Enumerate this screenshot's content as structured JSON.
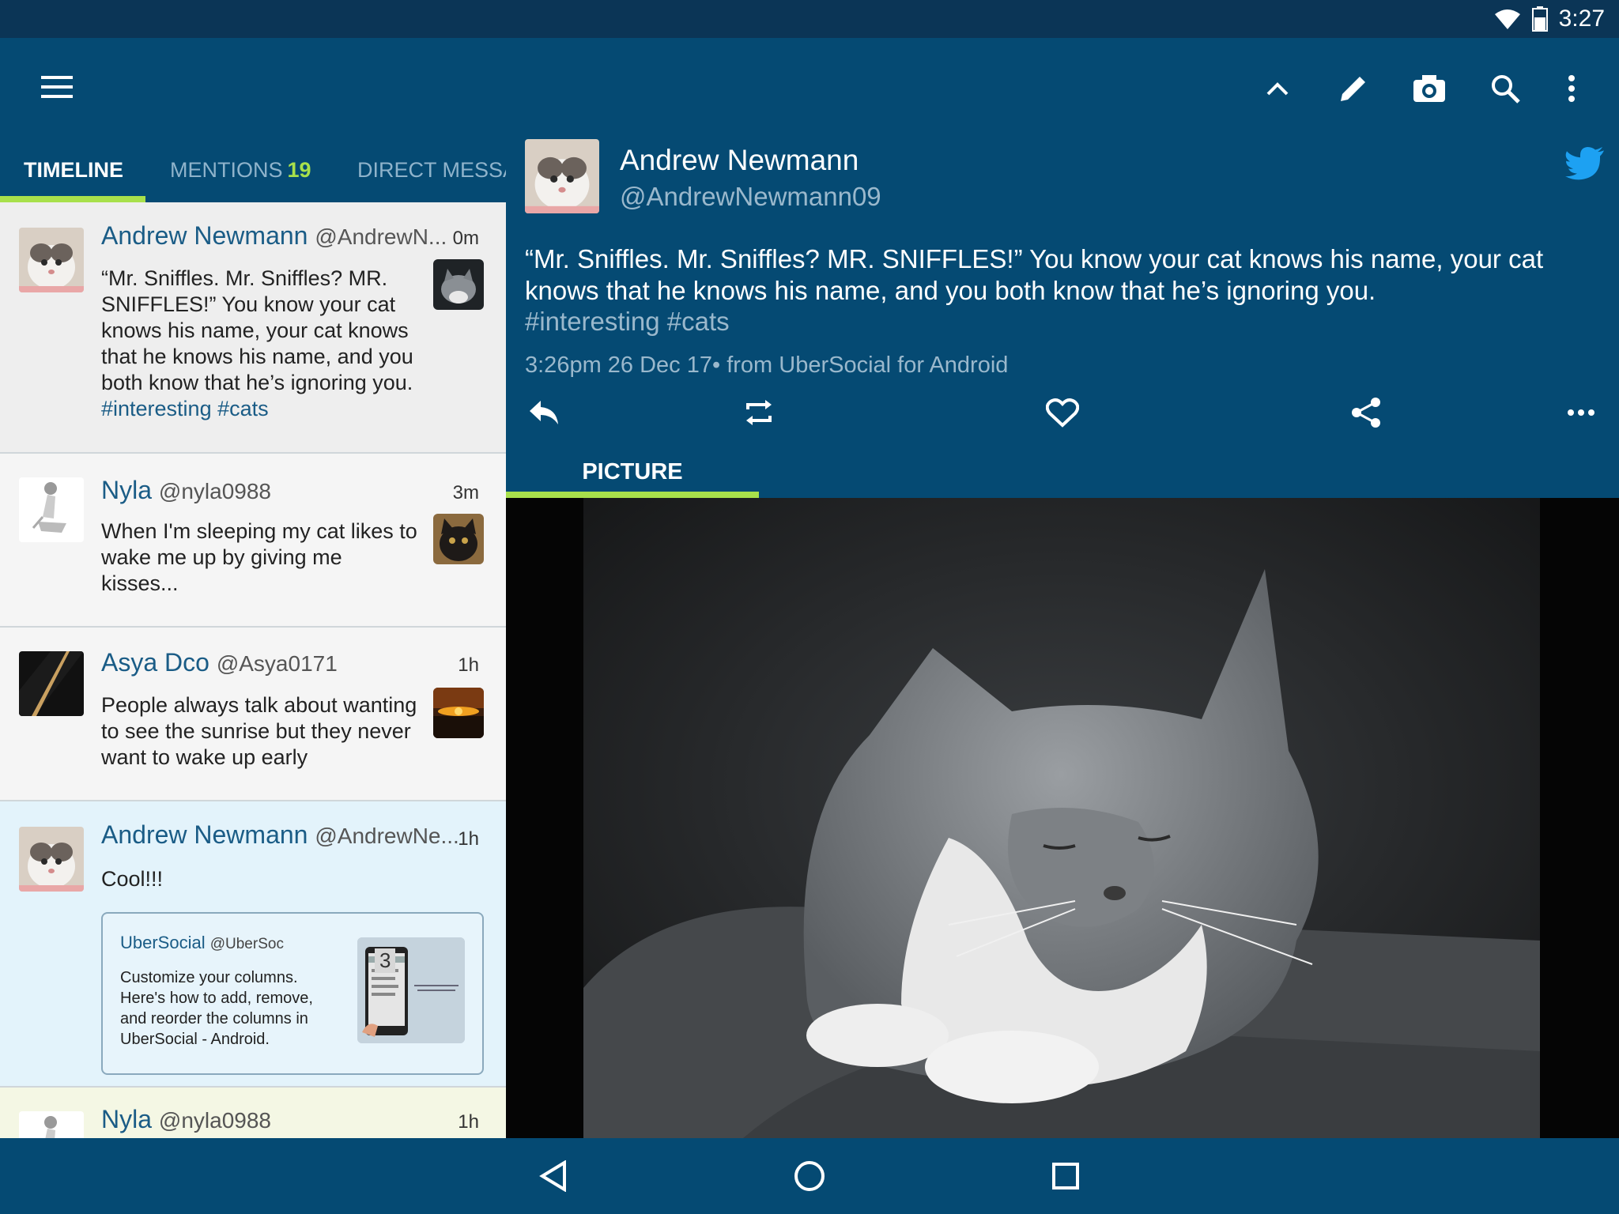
{
  "status_bar": {
    "time": "3:27"
  },
  "tabs": [
    {
      "label": "TIMELINE"
    },
    {
      "label": "MENTIONS",
      "count": "19"
    },
    {
      "label": "DIRECT MESSA"
    }
  ],
  "tweets": [
    {
      "name": "Andrew Newmann",
      "handle": "@AndrewN...",
      "age": "0m",
      "text": "“Mr. Sniffles. Mr. Sniffles? MR. SNIFFLES!” You know your cat knows his name, your cat knows that he knows his name, and you both know that he’s ignoring you.",
      "hashtags": "#interesting #cats"
    },
    {
      "name": "Nyla",
      "handle": "@nyla0988",
      "age": "3m",
      "text": "When I'm sleeping my cat likes to wake me up by giving me kisses..."
    },
    {
      "name": "Asya Dco",
      "handle": "@Asya0171",
      "age": "1h",
      "text": "People always talk about wanting to see the sunrise but they never want to wake up early"
    },
    {
      "name": "Andrew Newmann",
      "handle": "@AndrewNe...",
      "age": "1h",
      "text": "Cool!!!",
      "quote": {
        "name": "UberSocial",
        "handle": "@UberSoc",
        "text": "Customize your columns. Here's how to add, remove, and reorder the columns in UberSocial - Android.",
        "image_number": "3"
      }
    },
    {
      "name": "Nyla",
      "handle": "@nyla0988",
      "age": "1h"
    }
  ],
  "detail": {
    "name": "Andrew Newmann",
    "handle": "@AndrewNewmann09",
    "text": "“Mr. Sniffles. Mr. Sniffles? MR. SNIFFLES!” You know your cat knows his name, your cat knows that he knows his name, and you both know that he’s ignoring you.",
    "hashtags": "#interesting #cats",
    "meta": "3:26pm 26 Dec 17• from UberSocial for Android",
    "media_tab": "PICTURE"
  },
  "colors": {
    "app_bar": "#054a73",
    "accent": "#a8e04b",
    "link": "#1a5c86",
    "twitter_blue": "#1da1f2"
  },
  "icons": [
    "menu-icon",
    "chevron-up-icon",
    "pencil-icon",
    "camera-icon",
    "search-icon",
    "more-vert-icon",
    "twitter-bird-icon",
    "reply-icon",
    "retweet-icon",
    "heart-icon",
    "share-icon",
    "more-horiz-icon",
    "back-icon",
    "home-icon",
    "recents-icon"
  ]
}
